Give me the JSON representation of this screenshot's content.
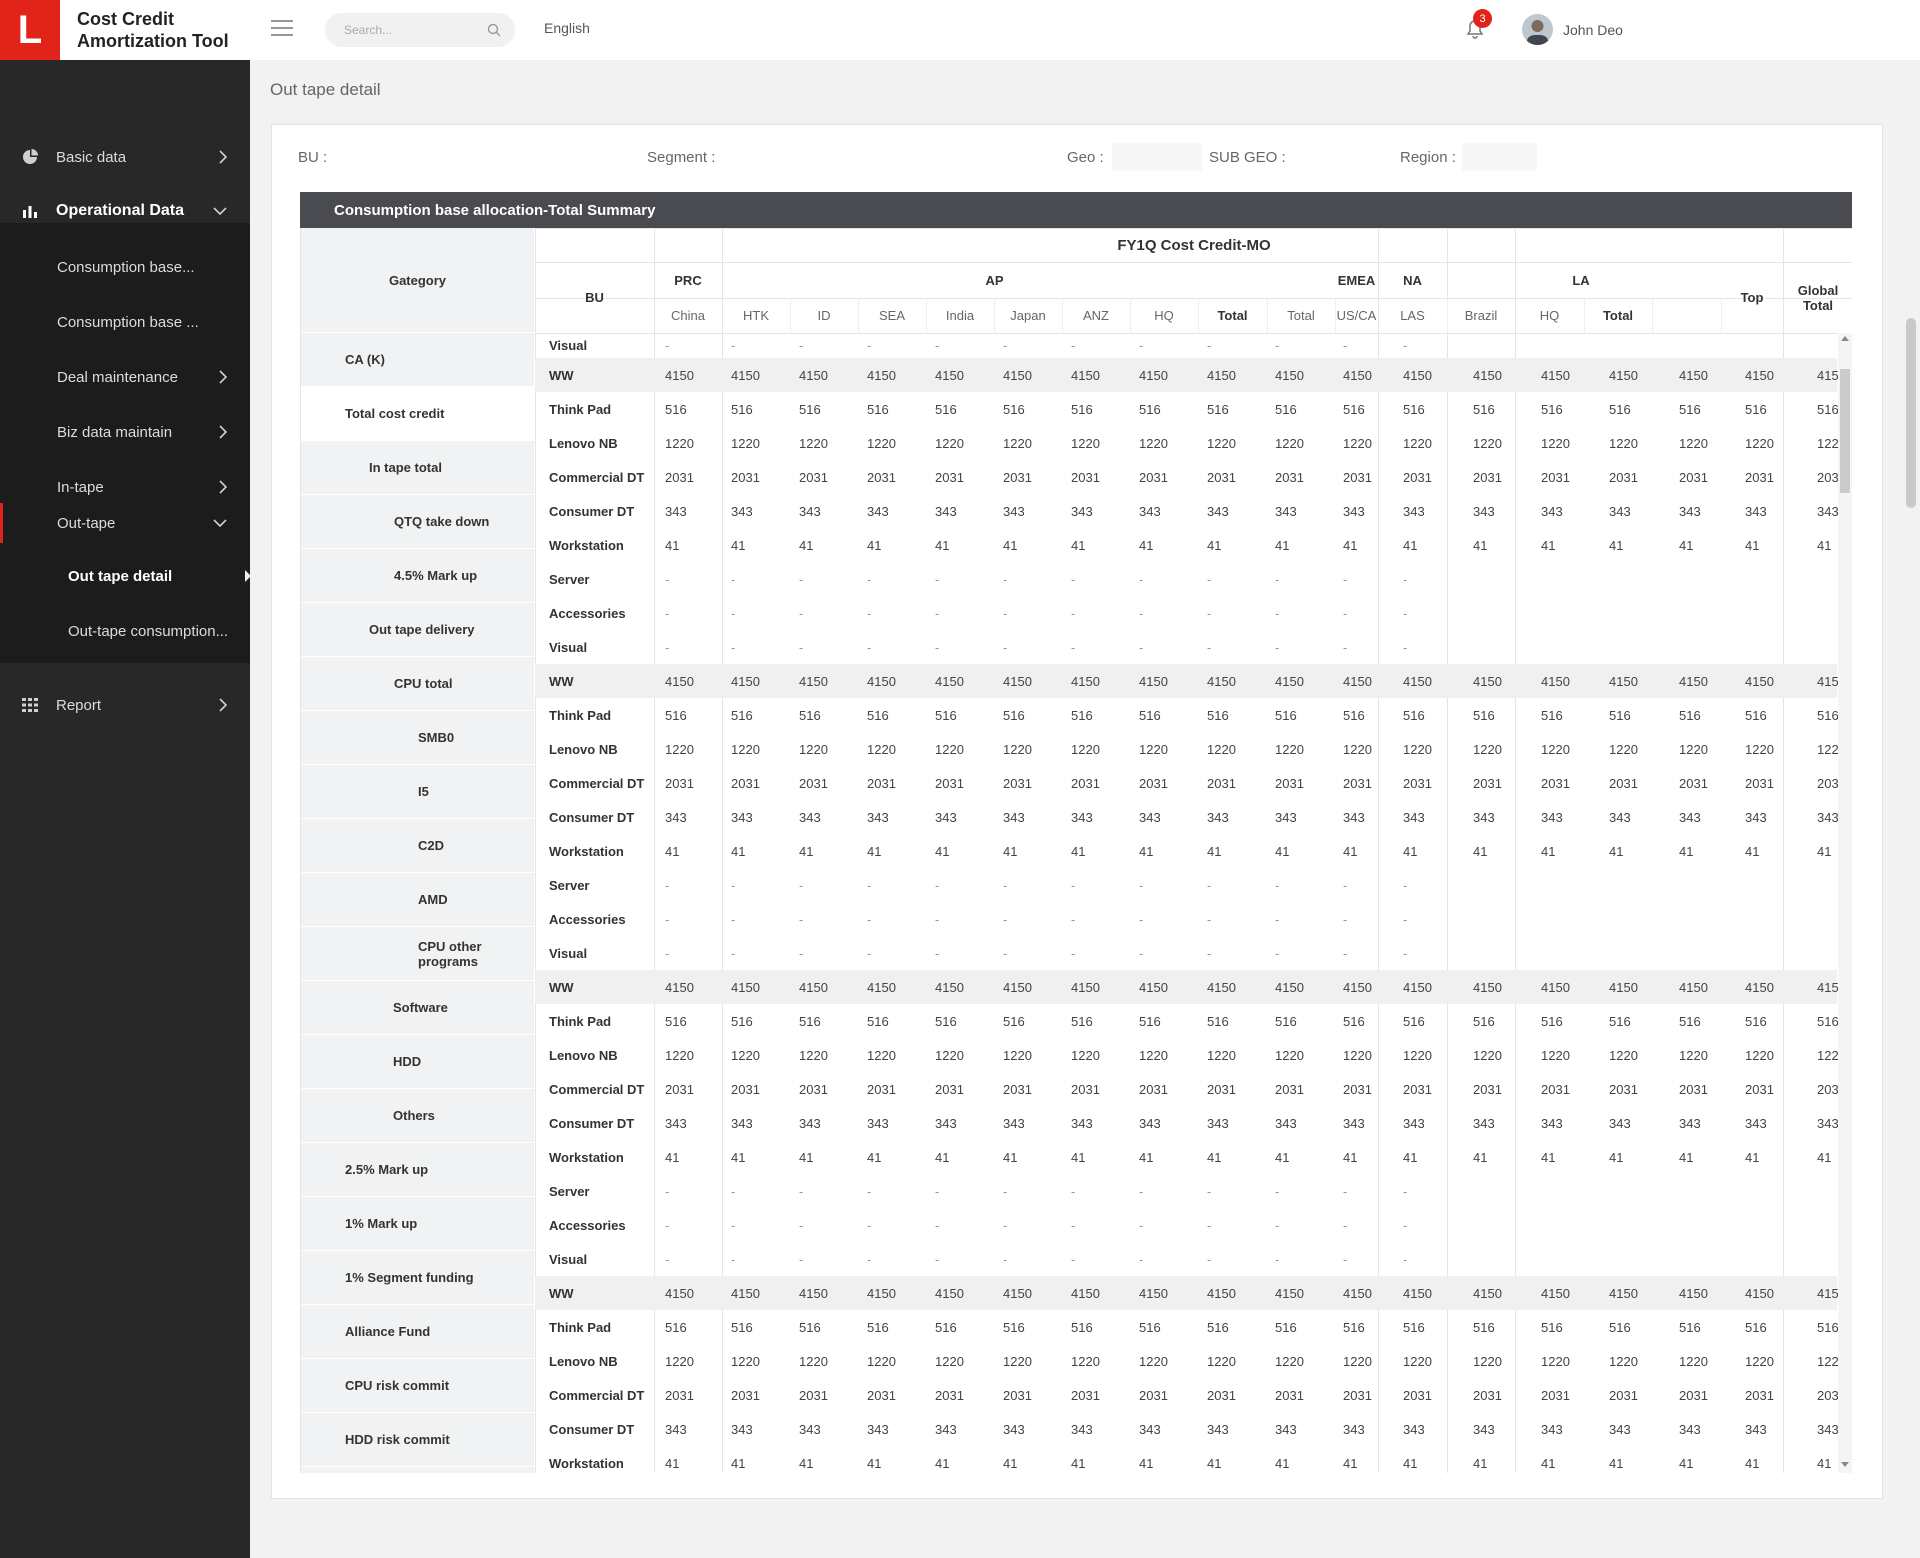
{
  "app": {
    "logo_letter": "L",
    "title": "Cost Credit Amortization Tool"
  },
  "header": {
    "search_placeholder": "Search...",
    "language": "English",
    "notification_count": "3",
    "user_name": "John Deo"
  },
  "sidebar": {
    "basic_data": "Basic data",
    "operational_data": "Operational Data",
    "consumption_base_1": "Consumption base...",
    "consumption_base_2": "Consumption base ...",
    "deal_maintenance": "Deal maintenance",
    "biz_data_maintain": "Biz data maintain",
    "in_tape": "In-tape",
    "out_tape": "Out-tape",
    "out_tape_detail": "Out tape detail",
    "out_tape_consumption": "Out-tape consumption...",
    "report": "Report"
  },
  "page": {
    "title": "Out tape detail"
  },
  "filters": {
    "bu": "BU :",
    "segment": "Segment :",
    "geo": "Geo :",
    "sub_geo": "SUB GEO :",
    "region": "Region :"
  },
  "table": {
    "title": "Consumption base allocation-Total Summary",
    "super_header": "FY1Q Cost Credit-MO",
    "gategory_label": "Gategory",
    "bu_label": "BU",
    "groups": {
      "prc": "PRC",
      "ap": "AP",
      "emea": "EMEA",
      "na": "NA",
      "la": "LA",
      "top": "Top",
      "global_total": "Global Total"
    },
    "columns": [
      "China",
      "HTK",
      "ID",
      "SEA",
      "India",
      "Japan",
      "ANZ",
      "HQ",
      "Total",
      "Total",
      "US/CA",
      "LAS",
      "Brazil",
      "HQ",
      "Total"
    ],
    "categories": {
      "ca_k": "CA (K)",
      "total_cost_credit": "Total cost credit",
      "in_tape_total": "In tape total",
      "qtq_take_down": "QTQ take down",
      "mark_up_45": "4.5% Mark up",
      "out_tape_delivery": "Out tape delivery",
      "cpu_total": "CPU total",
      "smb0": "SMB0",
      "i5": "I5",
      "c2d": "C2D",
      "amd": "AMD",
      "cpu_other_programs": "CPU other programs",
      "software": "Software",
      "hdd": "HDD",
      "others": "Others",
      "mark_up_25": "2.5% Mark up",
      "mark_up_1": "1% Mark up",
      "segment_funding_1": "1% Segment funding",
      "alliance_fund": "Alliance Fund",
      "cpu_risk_commit": "CPU risk commit",
      "hdd_risk_commit": "HDD risk commit"
    },
    "row_labels": {
      "ww": "WW",
      "think_pad": "Think Pad",
      "lenovo_nb": "Lenovo NB",
      "commercial_dt": "Commercial DT",
      "consumer_dt": "Consumer DT",
      "workstation": "Workstation",
      "server": "Server",
      "accessories": "Accessories",
      "visual": "Visual"
    },
    "values": {
      "ww": "4150",
      "think_pad": "516",
      "lenovo_nb": "1220",
      "commercial_dt": "2031",
      "consumer_dt": "343",
      "workstation": "41",
      "dash": "-"
    }
  }
}
